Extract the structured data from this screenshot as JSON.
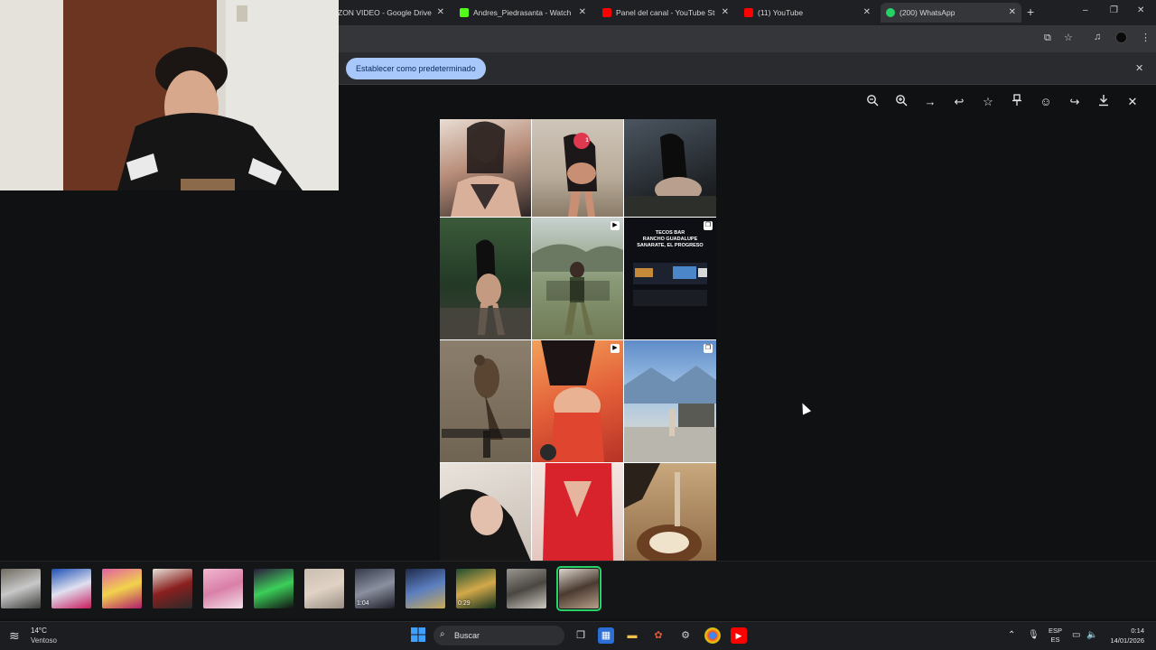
{
  "browser": {
    "tabs": [
      {
        "label": "ZON VIDEO - Google Drive",
        "favicon": "drive-icon"
      },
      {
        "label": "Andres_Piedrasanta - Watch the",
        "favicon": "kick-icon",
        "color": "#53fc18"
      },
      {
        "label": "Panel del canal - YouTube Studi",
        "favicon": "youtube-studio-icon",
        "color": "#ff0000"
      },
      {
        "label": "(11) YouTube",
        "favicon": "youtube-icon",
        "color": "#ff0000"
      },
      {
        "label": "(200) WhatsApp",
        "favicon": "whatsapp-icon",
        "color": "#25d366",
        "active": true
      }
    ],
    "new_tab": "+",
    "window_controls": [
      "–",
      "❐",
      "✕"
    ]
  },
  "infobar": {
    "button_label": "Establecer como predeterminado",
    "close": "✕"
  },
  "viewer": {
    "tools": [
      "zoom-out-icon",
      "zoom-in-icon",
      "forward-icon",
      "reply-icon",
      "star-icon",
      "pin-icon",
      "emoji-icon",
      "share-icon",
      "download-icon",
      "close-icon"
    ]
  },
  "media": {
    "texts": {
      "tecos_line1": "TECOS BAR",
      "tecos_line2": "RANCHO GUADALUPE",
      "tecos_line3": "SANARATE, EL PROGRESO",
      "heart_count": "1"
    }
  },
  "thumbnails": [
    {
      "name": "thumb-1"
    },
    {
      "name": "thumb-2"
    },
    {
      "name": "thumb-3"
    },
    {
      "name": "thumb-4"
    },
    {
      "name": "thumb-5"
    },
    {
      "name": "thumb-6"
    },
    {
      "name": "thumb-7"
    },
    {
      "name": "thumb-8",
      "duration": "1:04"
    },
    {
      "name": "thumb-9"
    },
    {
      "name": "thumb-10",
      "duration": "0:29"
    },
    {
      "name": "thumb-11"
    },
    {
      "name": "thumb-12",
      "selected": true
    }
  ],
  "taskbar": {
    "weather_temp": "14°C",
    "weather_desc": "Ventoso",
    "search_label": "Buscar",
    "lang_line1": "ESP",
    "lang_line2": "ES",
    "time": "0:14",
    "date": "14/01/2026"
  },
  "colors": {
    "accent_button": "#a8c7fa",
    "whatsapp_green": "#25d366"
  }
}
